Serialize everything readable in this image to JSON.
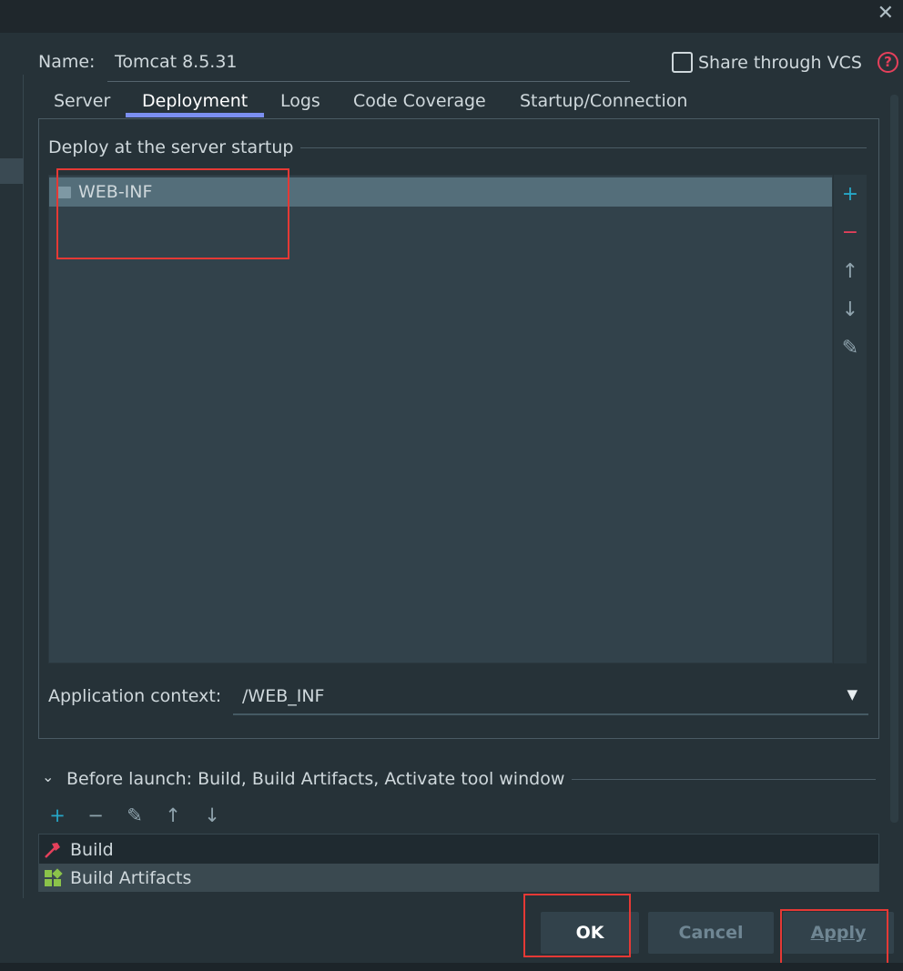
{
  "window": {
    "close_glyph": "✕"
  },
  "header": {
    "name_label": "Name:",
    "name_value": "Tomcat 8.5.31",
    "share_label": "Share through VCS",
    "help_glyph": "?"
  },
  "tabs": [
    {
      "label": "Server",
      "active": false
    },
    {
      "label": "Deployment",
      "active": true
    },
    {
      "label": "Logs",
      "active": false
    },
    {
      "label": "Code Coverage",
      "active": false
    },
    {
      "label": "Startup/Connection",
      "active": false
    }
  ],
  "deployment": {
    "group_title": "Deploy at the server startup",
    "items": [
      {
        "label": "WEB-INF",
        "icon": "folder-icon"
      }
    ],
    "toolbar": [
      {
        "name": "add-icon",
        "glyph": "+",
        "color": "#26a7c7"
      },
      {
        "name": "remove-icon",
        "glyph": "−",
        "color": "#e5405b"
      },
      {
        "name": "move-up-icon",
        "glyph": "↑",
        "color": "#7d8f98"
      },
      {
        "name": "move-down-icon",
        "glyph": "↓",
        "color": "#7d8f98"
      },
      {
        "name": "edit-icon",
        "glyph": "✎",
        "color": "#7d8f98"
      }
    ],
    "app_context_label": "Application context:",
    "app_context_value": "/WEB_INF",
    "dropdown_glyph": "▼"
  },
  "before_launch": {
    "chevron_glyph": "⌄",
    "title": "Before launch: Build, Build Artifacts, Activate tool window",
    "toolbar": [
      {
        "name": "add-icon",
        "glyph": "+",
        "color": "#26a7c7"
      },
      {
        "name": "remove-icon",
        "glyph": "−",
        "color": "#7d8f98"
      },
      {
        "name": "edit-icon",
        "glyph": "✎",
        "color": "#7d8f98"
      },
      {
        "name": "move-up-icon",
        "glyph": "↑",
        "color": "#7d8f98"
      },
      {
        "name": "move-down-icon",
        "glyph": "↓",
        "color": "#7d8f98"
      }
    ],
    "items": [
      {
        "label": "Build",
        "icon": "hammer-icon"
      },
      {
        "label": "Build Artifacts",
        "icon": "artifacts-icon"
      }
    ]
  },
  "buttons": {
    "ok": "OK",
    "cancel": "Cancel",
    "apply": "Apply"
  },
  "colors": {
    "accent_tab": "#7b8ff0",
    "highlight_red": "#e53935",
    "selected_row": "#546e7a"
  }
}
